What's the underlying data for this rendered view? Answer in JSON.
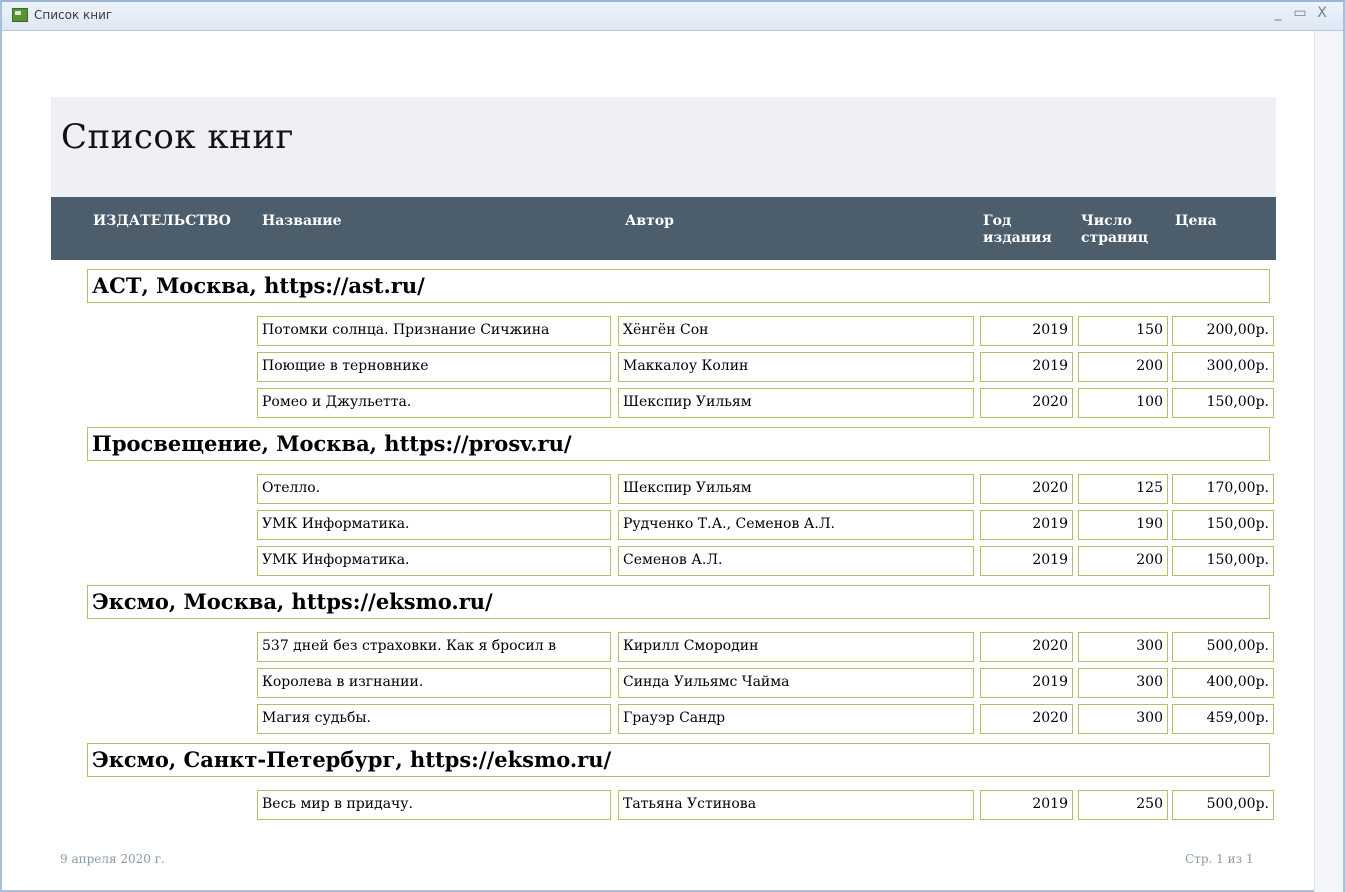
{
  "window": {
    "title": "Список книг",
    "controls": [
      "_",
      "▭",
      "X"
    ]
  },
  "report": {
    "title": "Список книг",
    "columns": {
      "publisher": "ИЗДАТЕЛЬСТВО",
      "name": "Название",
      "author": "Автор",
      "year_l1": "Год",
      "year_l2": "издания",
      "pages_l1": "Число",
      "pages_l2": "страниц",
      "price": "Цена"
    },
    "groups": [
      {
        "header": "АСТ, Москва, https://ast.ru/",
        "rows": [
          {
            "name": "Потомки солнца. Признание Сичжина",
            "author": "Хёнгён Сон",
            "year": "2019",
            "pages": "150",
            "price": "200,00р."
          },
          {
            "name": "Поющие в терновнике",
            "author": "Маккалоу Колин",
            "year": "2019",
            "pages": "200",
            "price": "300,00р."
          },
          {
            "name": "Ромео и Джульетта.",
            "author": "Шекспир Уильям",
            "year": "2020",
            "pages": "100",
            "price": "150,00р."
          }
        ]
      },
      {
        "header": "Просвещение, Москва, https://prosv.ru/",
        "rows": [
          {
            "name": "Отелло.",
            "author": "Шекспир Уильям",
            "year": "2020",
            "pages": "125",
            "price": "170,00р."
          },
          {
            "name": "УМК Информатика.",
            "author": "Рудченко Т.А., Семенов А.Л.",
            "year": "2019",
            "pages": "190",
            "price": "150,00р."
          },
          {
            "name": "УМК Информатика.",
            "author": "Семенов А.Л.",
            "year": "2019",
            "pages": "200",
            "price": "150,00р."
          }
        ]
      },
      {
        "header": "Эксмо, Москва, https://eksmo.ru/",
        "rows": [
          {
            "name": "537 дней без страховки. Как я бросил в",
            "author": "Кирилл Смородин",
            "year": "2020",
            "pages": "300",
            "price": "500,00р."
          },
          {
            "name": "Королева в изгнании.",
            "author": "Синда Уильямс Чайма",
            "year": "2019",
            "pages": "300",
            "price": "400,00р."
          },
          {
            "name": "Магия судьбы.",
            "author": "Грауэр Сандр",
            "year": "2020",
            "pages": "300",
            "price": "459,00р."
          }
        ]
      },
      {
        "header": "Эксмо, Санкт-Петербург, https://eksmo.ru/",
        "rows": [
          {
            "name": "Весь мир в придачу.",
            "author": "Татьяна Устинова",
            "year": "2019",
            "pages": "250",
            "price": "500,00р."
          }
        ]
      }
    ]
  },
  "footer": {
    "date": "9 апреля 2020 г.",
    "page": "Стр. 1 из 1"
  },
  "colors": {
    "header_bg": "#4c5d6b",
    "title_bg": "#eef0f3",
    "cell_border": "#b9bd6a"
  }
}
